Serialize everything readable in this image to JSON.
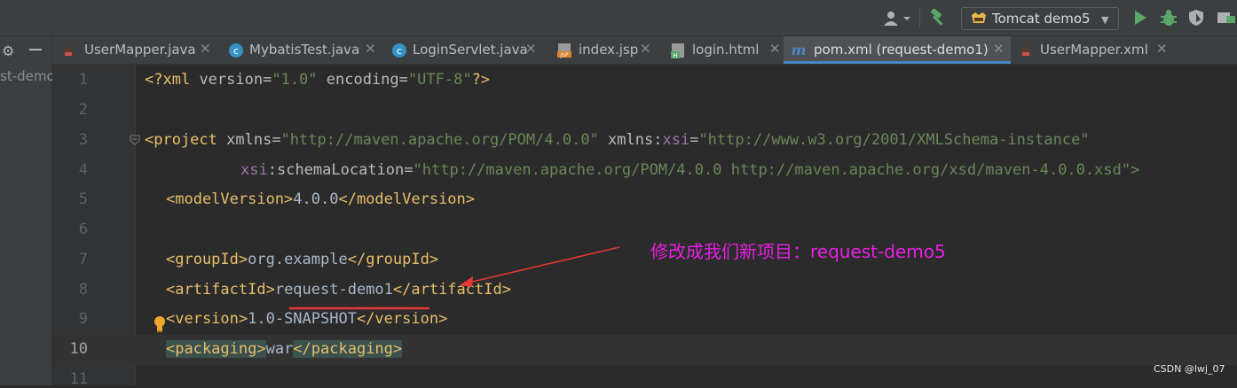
{
  "toolbar": {
    "run_config_label": "Tomcat demo5",
    "icons": [
      "user-icon",
      "hammer-icon",
      "tomcat-icon",
      "run-icon",
      "debug-icon",
      "coverage-icon"
    ]
  },
  "left_panel": {
    "project_label": "st-demo"
  },
  "tabs": [
    {
      "label": "UserMapper.java",
      "icon": "java-interface-icon"
    },
    {
      "label": "MybatisTest.java",
      "icon": "java-class-icon"
    },
    {
      "label": "LoginServlet.java",
      "icon": "java-class-icon"
    },
    {
      "label": "index.jsp",
      "icon": "jsp-file-icon"
    },
    {
      "label": "login.html",
      "icon": "html-file-icon"
    },
    {
      "label": "pom.xml (request-demo1)",
      "icon": "maven-icon",
      "active": true
    },
    {
      "label": "UserMapper.xml",
      "icon": "xml-file-icon"
    }
  ],
  "editor": {
    "line_numbers": [
      "1",
      "2",
      "3",
      "4",
      "5",
      "6",
      "7",
      "8",
      "9",
      "10",
      "11"
    ],
    "current_line": "10",
    "code": {
      "l1": {
        "open": "<?",
        "name": "xml",
        "a1": " version",
        "eq1": "=",
        "v1": "\"1.0\"",
        "a2": " encoding",
        "eq2": "=",
        "v2": "\"UTF-8\"",
        "close": "?>"
      },
      "l3": {
        "open": "<project",
        "a1": " xmlns",
        "eq1": "=",
        "v1": "\"http://maven.apache.org/POM/4.0.0\"",
        "a2": " xmlns",
        "colon": ":",
        "a2p": "xsi",
        "eq2": "=",
        "v2": "\"http://www.w3.org/2001/XMLSchema-instance\""
      },
      "l4": {
        "prefix": "xsi",
        "colon": ":",
        "attr": "schemaLocation",
        "eq": "=",
        "v": "\"http://maven.apache.org/POM/4.0.0 http://maven.apache.org/xsd/maven-4.0.0.xsd\">"
      },
      "l5": {
        "open": "<modelVersion>",
        "text": "4.0.0",
        "close": "</modelVersion>"
      },
      "l7": {
        "open": "<groupId>",
        "text": "org.example",
        "close": "</groupId>"
      },
      "l8": {
        "open": "<artifactId>",
        "text": "request-demo1",
        "close": "</artifactId>"
      },
      "l9": {
        "open": "<version>",
        "text": "1.0-SNAPSHOT",
        "close": "</version>"
      },
      "l10": {
        "open": "<packaging>",
        "text": "war",
        "close": "</packaging>"
      }
    }
  },
  "annotation": {
    "note": "修改成我们新项目：request-demo5",
    "color": "#E91FE5",
    "arrow_color": "#E53935"
  },
  "watermark": "CSDN @lwj_07"
}
